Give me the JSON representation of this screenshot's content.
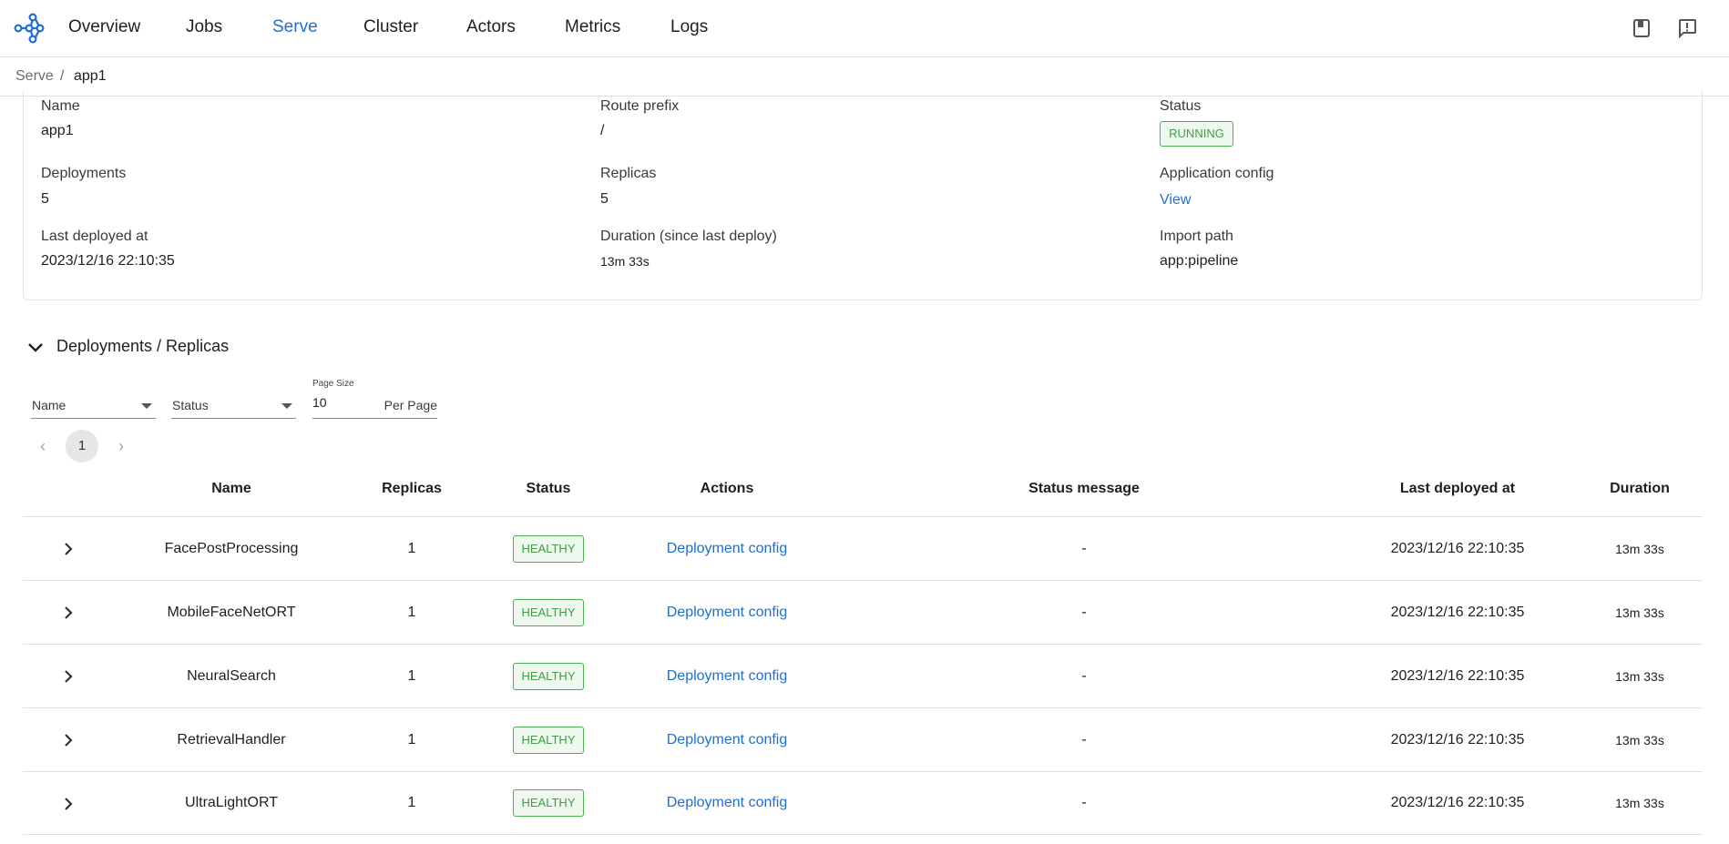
{
  "nav": {
    "items": [
      {
        "label": "Overview",
        "active": false
      },
      {
        "label": "Jobs",
        "active": false
      },
      {
        "label": "Serve",
        "active": true
      },
      {
        "label": "Cluster",
        "active": false
      },
      {
        "label": "Actors",
        "active": false
      },
      {
        "label": "Metrics",
        "active": false
      },
      {
        "label": "Logs",
        "active": false
      }
    ],
    "icons": [
      "docs-book-icon",
      "feedback-icon"
    ],
    "accent": "#1e6fd0"
  },
  "breadcrumb": {
    "parent": "Serve",
    "separator": "/",
    "current": "app1"
  },
  "app": {
    "name_label": "Name",
    "name": "app1",
    "route_label": "Route prefix",
    "route": "/",
    "status_label": "Status",
    "status": "RUNNING",
    "deployments_label": "Deployments",
    "deployments": "5",
    "replicas_label": "Replicas",
    "replicas": "5",
    "config_label": "Application config",
    "config_link": "View",
    "last_deployed_label": "Last deployed at",
    "last_deployed": "2023/12/16 22:10:35",
    "duration_label": "Duration (since last deploy)",
    "duration": "13m 33s",
    "import_label": "Import path",
    "import_path": "app:pipeline"
  },
  "section": {
    "title": "Deployments / Replicas"
  },
  "filters": {
    "name_select": "Name",
    "status_select": "Status",
    "page_size_label": "Page Size",
    "page_size": "10",
    "page_size_suffix": "Per Page"
  },
  "pagination": {
    "prev": "‹",
    "current": "1",
    "next": "›"
  },
  "table": {
    "headers": {
      "name": "Name",
      "replicas": "Replicas",
      "status": "Status",
      "actions": "Actions",
      "status_message": "Status message",
      "last_deployed": "Last deployed at",
      "duration": "Duration"
    },
    "rows": [
      {
        "name": "FacePostProcessing",
        "replicas": "1",
        "status": "HEALTHY",
        "action": "Deployment config",
        "message": "-",
        "last_deployed": "2023/12/16 22:10:35",
        "duration": "13m 33s"
      },
      {
        "name": "MobileFaceNetORT",
        "replicas": "1",
        "status": "HEALTHY",
        "action": "Deployment config",
        "message": "-",
        "last_deployed": "2023/12/16 22:10:35",
        "duration": "13m 33s"
      },
      {
        "name": "NeuralSearch",
        "replicas": "1",
        "status": "HEALTHY",
        "action": "Deployment config",
        "message": "-",
        "last_deployed": "2023/12/16 22:10:35",
        "duration": "13m 33s"
      },
      {
        "name": "RetrievalHandler",
        "replicas": "1",
        "status": "HEALTHY",
        "action": "Deployment config",
        "message": "-",
        "last_deployed": "2023/12/16 22:10:35",
        "duration": "13m 33s"
      },
      {
        "name": "UltraLightORT",
        "replicas": "1",
        "status": "HEALTHY",
        "action": "Deployment config",
        "message": "-",
        "last_deployed": "2023/12/16 22:10:35",
        "duration": "13m 33s"
      }
    ]
  },
  "colors": {
    "healthy": "#3f9c43",
    "link": "#1e6fd0"
  }
}
